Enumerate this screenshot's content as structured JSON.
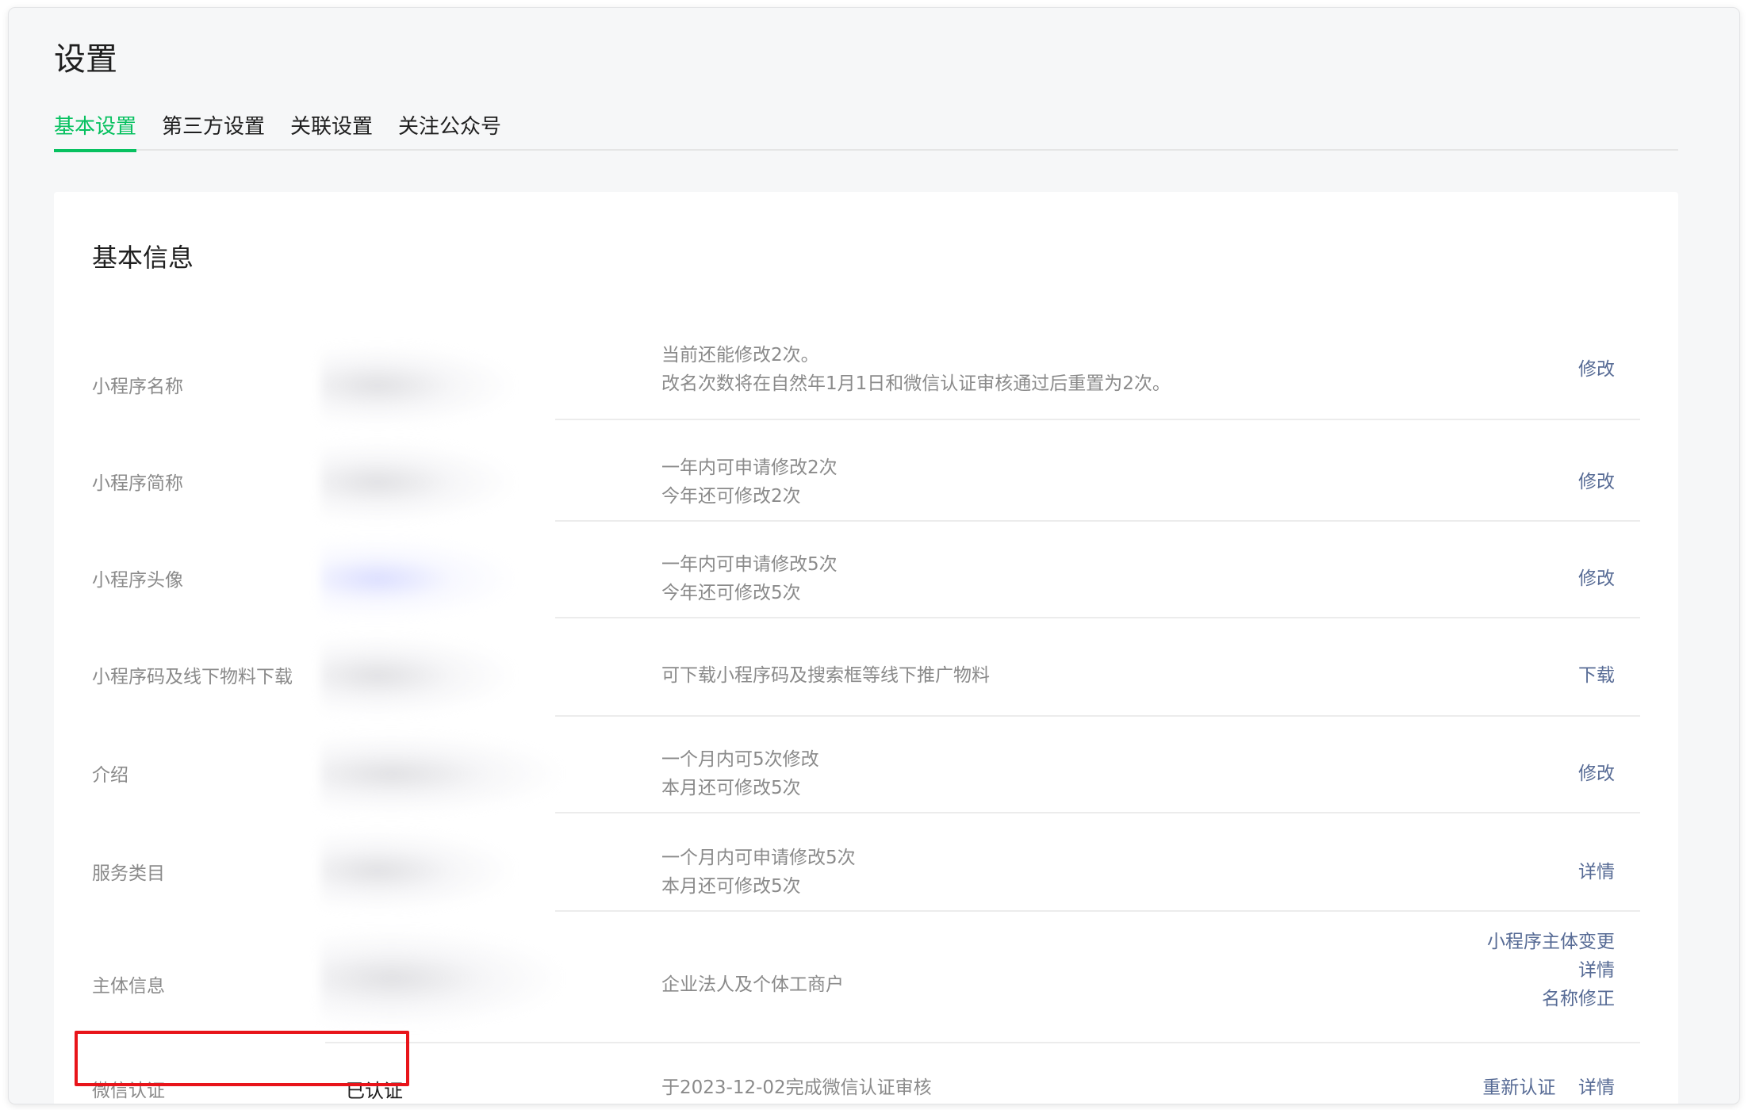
{
  "page": {
    "title": "设置"
  },
  "tabs": [
    {
      "label": "基本设置",
      "active": true
    },
    {
      "label": "第三方设置",
      "active": false
    },
    {
      "label": "关联设置",
      "active": false
    },
    {
      "label": "关注公众号",
      "active": false
    }
  ],
  "card": {
    "title": "基本信息",
    "rows": [
      {
        "label": "小程序名称",
        "desc": [
          "当前还能修改2次。",
          "改名次数将在自然年1月1日和微信认证审核通过后重置为2次。"
        ],
        "actions": [
          "修改"
        ]
      },
      {
        "label": "小程序简称",
        "desc": [
          "一年内可申请修改2次",
          "今年还可修改2次"
        ],
        "actions": [
          "修改"
        ]
      },
      {
        "label": "小程序头像",
        "desc": [
          "一年内可申请修改5次",
          "今年还可修改5次"
        ],
        "actions": [
          "修改"
        ]
      },
      {
        "label": "小程序码及线下物料下载",
        "desc": [
          "可下载小程序码及搜索框等线下推广物料"
        ],
        "actions": [
          "下载"
        ]
      },
      {
        "label": "介绍",
        "desc": [
          "一个月内可5次修改",
          "本月还可修改5次"
        ],
        "actions": [
          "修改"
        ]
      },
      {
        "label": "服务类目",
        "desc": [
          "一个月内可申请修改5次",
          "本月还可修改5次"
        ],
        "actions": [
          "详情"
        ]
      },
      {
        "label": "主体信息",
        "desc": [
          "企业法人及个体工商户"
        ],
        "actions": [
          "小程序主体变更",
          "详情",
          "名称修正"
        ]
      },
      {
        "label": "微信认证",
        "status": "已认证",
        "desc": [
          "于2023-12-02完成微信认证审核"
        ],
        "actions": [
          "重新认证",
          "详情"
        ]
      }
    ]
  },
  "colors": {
    "accent": "#07c160",
    "link": "#576b95",
    "highlight": "#e8141a"
  }
}
